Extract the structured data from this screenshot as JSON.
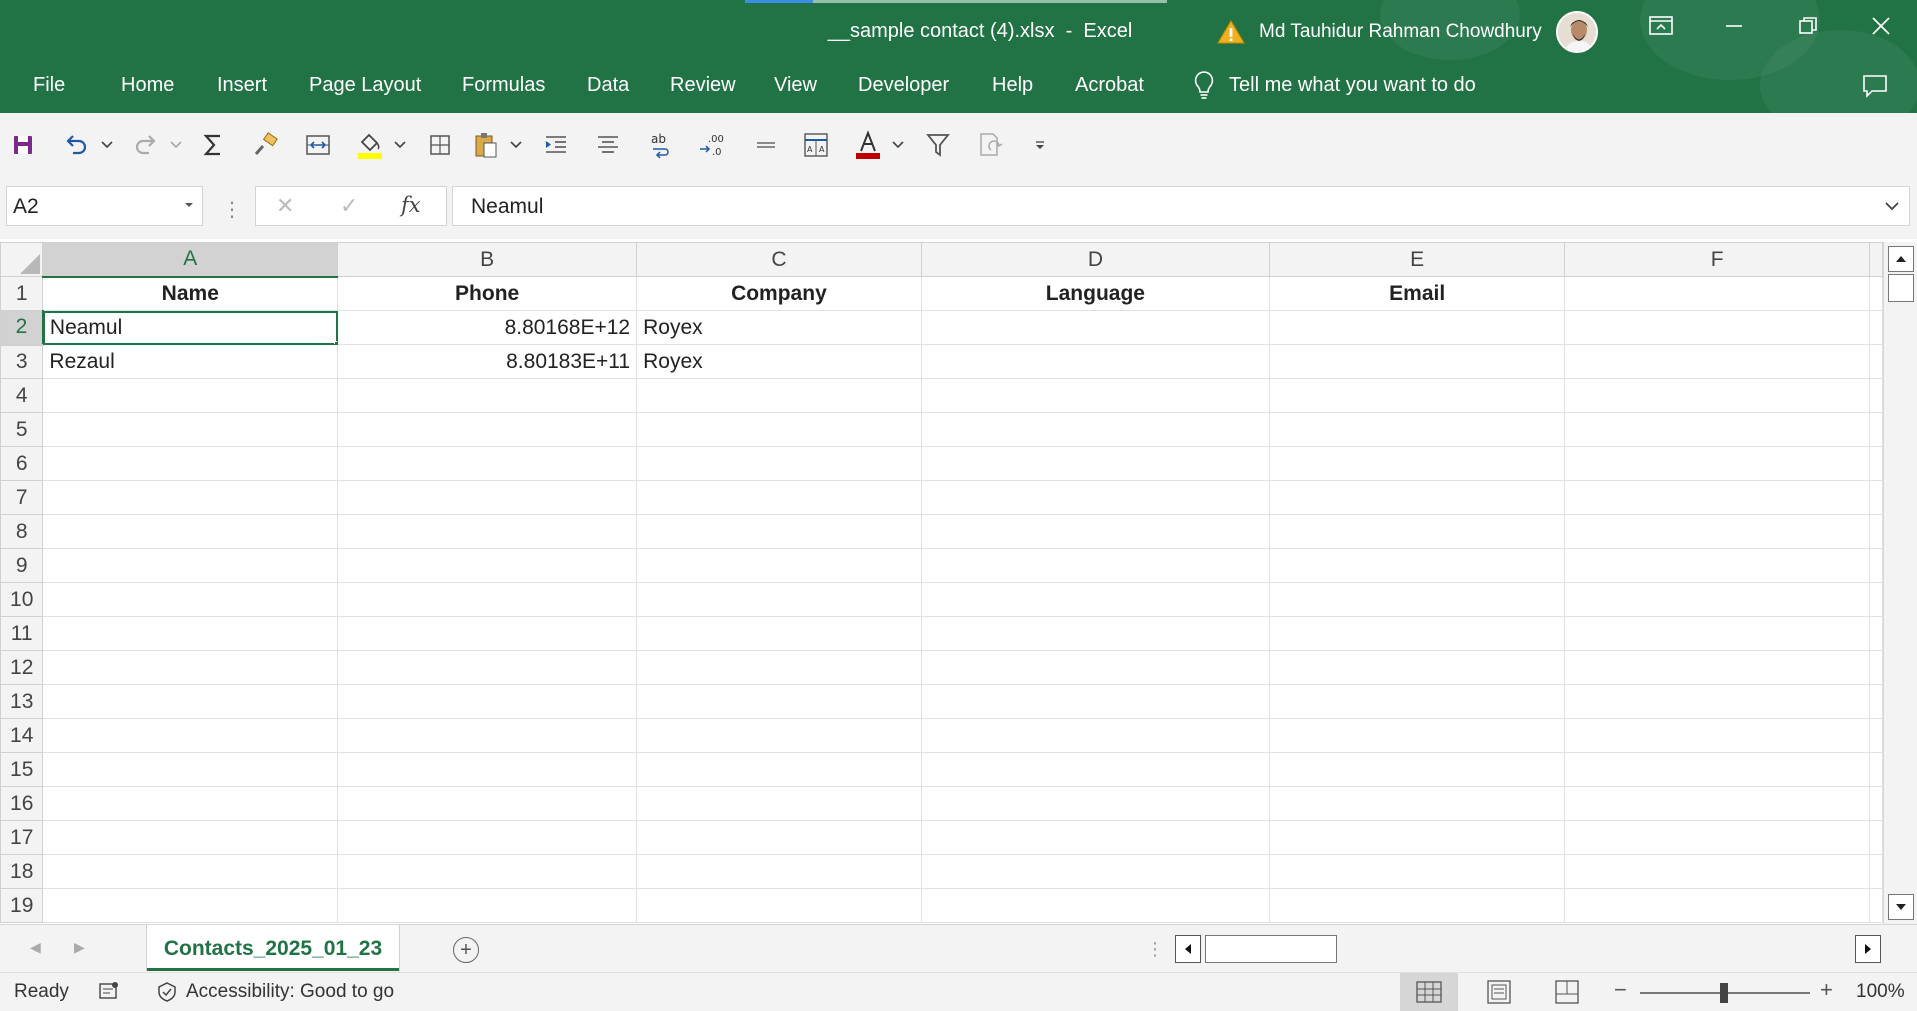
{
  "window": {
    "title": "__sample contact (4).xlsx  -  Excel",
    "user_name": "Md Tauhidur Rahman Chowdhury",
    "loading_progress": 0.16
  },
  "ribbon_tabs": [
    "File",
    "Home",
    "Insert",
    "Page Layout",
    "Formulas",
    "Data",
    "Review",
    "View",
    "Developer",
    "Help",
    "Acrobat"
  ],
  "tell_me": "Tell me what you want to do",
  "formula_bar": {
    "name_box": "A2",
    "fx_label": "fx",
    "content": "Neamul"
  },
  "sheet": {
    "columns": [
      "A",
      "B",
      "C",
      "D",
      "E",
      "F"
    ],
    "selected_column": "A",
    "selected_row": 2,
    "rows": [
      {
        "num": "1",
        "cells": [
          "Name",
          "Phone",
          "Company",
          "Language",
          "Email",
          ""
        ]
      },
      {
        "num": "2",
        "cells": [
          "Neamul",
          "8.80168E+12",
          "Royex",
          "",
          "",
          ""
        ]
      },
      {
        "num": "3",
        "cells": [
          "Rezaul",
          "8.80183E+11",
          "Royex",
          "",
          "",
          ""
        ]
      },
      {
        "num": "4",
        "cells": [
          "",
          "",
          "",
          "",
          "",
          ""
        ]
      },
      {
        "num": "5",
        "cells": [
          "",
          "",
          "",
          "",
          "",
          ""
        ]
      },
      {
        "num": "6",
        "cells": [
          "",
          "",
          "",
          "",
          "",
          ""
        ]
      },
      {
        "num": "7",
        "cells": [
          "",
          "",
          "",
          "",
          "",
          ""
        ]
      },
      {
        "num": "8",
        "cells": [
          "",
          "",
          "",
          "",
          "",
          ""
        ]
      },
      {
        "num": "9",
        "cells": [
          "",
          "",
          "",
          "",
          "",
          ""
        ]
      },
      {
        "num": "10",
        "cells": [
          "",
          "",
          "",
          "",
          "",
          ""
        ]
      },
      {
        "num": "11",
        "cells": [
          "",
          "",
          "",
          "",
          "",
          ""
        ]
      },
      {
        "num": "12",
        "cells": [
          "",
          "",
          "",
          "",
          "",
          ""
        ]
      },
      {
        "num": "13",
        "cells": [
          "",
          "",
          "",
          "",
          "",
          ""
        ]
      },
      {
        "num": "14",
        "cells": [
          "",
          "",
          "",
          "",
          "",
          ""
        ]
      },
      {
        "num": "15",
        "cells": [
          "",
          "",
          "",
          "",
          "",
          ""
        ]
      },
      {
        "num": "16",
        "cells": [
          "",
          "",
          "",
          "",
          "",
          ""
        ]
      },
      {
        "num": "17",
        "cells": [
          "",
          "",
          "",
          "",
          "",
          ""
        ]
      },
      {
        "num": "18",
        "cells": [
          "",
          "",
          "",
          "",
          "",
          ""
        ]
      },
      {
        "num": "19",
        "cells": [
          "",
          "",
          "",
          "",
          "",
          ""
        ]
      }
    ]
  },
  "sheet_tabs": {
    "active": "Contacts_2025_01_23"
  },
  "status_bar": {
    "ready": "Ready",
    "accessibility": "Accessibility: Good to go",
    "zoom": "100%"
  },
  "colors": {
    "excel_green": "#217346",
    "highlight_yellow": "#ffff00",
    "font_red": "#c00000"
  }
}
